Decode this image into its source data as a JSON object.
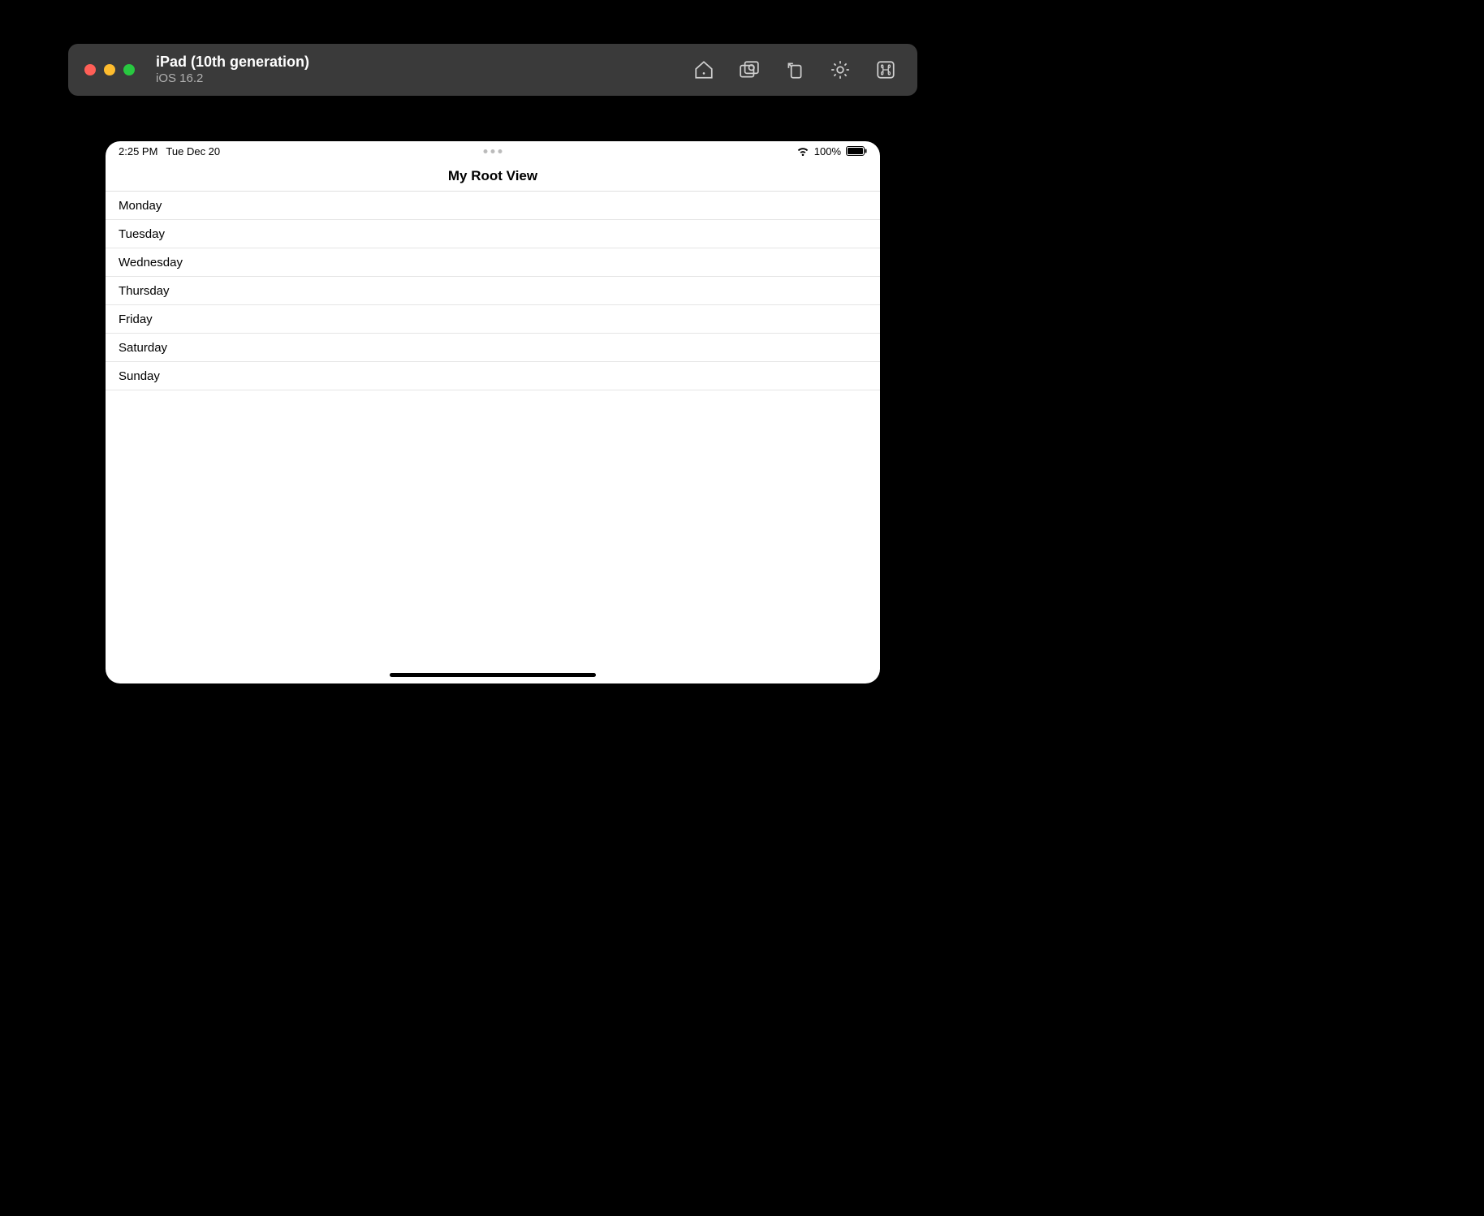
{
  "simulator": {
    "device_name": "iPad (10th generation)",
    "os_version": "iOS 16.2"
  },
  "status_bar": {
    "time": "2:25 PM",
    "date": "Tue Dec 20",
    "battery_percent": "100%"
  },
  "nav": {
    "title": "My Root View"
  },
  "list": {
    "items": [
      {
        "label": "Monday"
      },
      {
        "label": "Tuesday"
      },
      {
        "label": "Wednesday"
      },
      {
        "label": "Thursday"
      },
      {
        "label": "Friday"
      },
      {
        "label": "Saturday"
      },
      {
        "label": "Sunday"
      }
    ]
  }
}
